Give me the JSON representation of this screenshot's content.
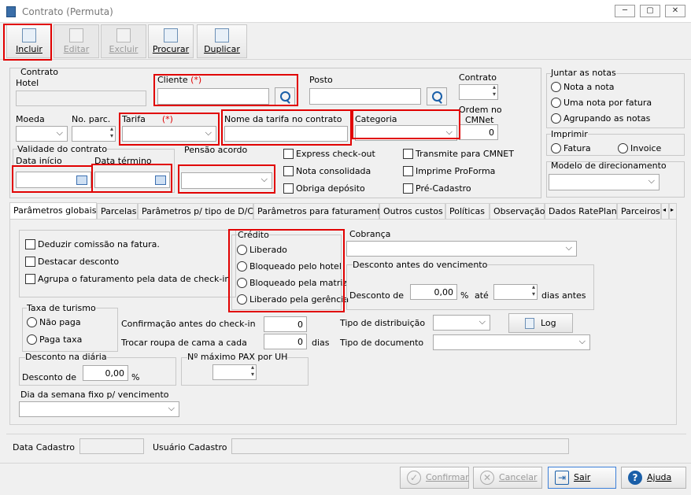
{
  "window": {
    "title": "Contrato (Permuta)",
    "min": "─",
    "max": "▢",
    "close": "✕"
  },
  "toolbar": {
    "incluir": "Incluir",
    "editar": "Editar",
    "excluir": "Excluir",
    "procurar": "Procurar",
    "duplicar": "Duplicar"
  },
  "contrato_group": {
    "label": "Contrato",
    "hotel": "Hotel"
  },
  "cliente": {
    "label": "Cliente",
    "req": "(*)",
    "value": ""
  },
  "posto": {
    "label": "Posto",
    "value": ""
  },
  "contrato_num": {
    "label": "Contrato",
    "value": ""
  },
  "ordem": {
    "label1": "Ordem no",
    "label2": "CMNet",
    "value": "0"
  },
  "moeda": {
    "label": "Moeda"
  },
  "noparc": {
    "label": "No. parc."
  },
  "tarifa": {
    "label": "Tarifa",
    "req": "(*)"
  },
  "nome_tarifa": {
    "label": "Nome da tarifa no contrato"
  },
  "categoria": {
    "label": "Categoria"
  },
  "validade": {
    "label": "Validade do contrato",
    "inicio": "Data início",
    "termino": "Data término"
  },
  "pensao": {
    "label": "Pensão acordo"
  },
  "checks": {
    "express": "Express check-out",
    "nota_consolidada": "Nota consolidada",
    "obriga": "Obriga depósito",
    "transmite": "Transmite para CMNET",
    "proforma": "Imprime ProForma",
    "precadastro": "Pré-Cadastro"
  },
  "juntar": {
    "label": "Juntar as notas",
    "opt1": "Nota a nota",
    "opt2": "Uma nota por fatura",
    "opt3": "Agrupando as notas"
  },
  "imprimir": {
    "label": "Imprimir",
    "opt1": "Fatura",
    "opt2": "Invoice"
  },
  "direcionamento": {
    "label": "Modelo de direcionamento"
  },
  "tabs": [
    "Parâmetros globais",
    "Parcelas",
    "Parâmetros p/ tipo de D/C",
    "Parâmetros para faturamento",
    "Outros custos",
    "Políticas",
    "Observação",
    "Dados RatePlan",
    "Parceiros"
  ],
  "panel": {
    "deduzir": "Deduzir comissão na fatura.",
    "destacar": "Destacar desconto",
    "agrupa": "Agrupa o faturamento pela data de check-in",
    "credito": {
      "label": "Crédito",
      "o1": "Liberado",
      "o2": "Bloqueado pelo hotel",
      "o3": "Bloqueado pela matriz",
      "o4": "Liberado pela gerência"
    },
    "cobranca": "Cobrança",
    "desc_venc": {
      "label": "Desconto antes do vencimento",
      "desconto_de": "Desconto de",
      "value": "0,00",
      "pct": "%",
      "ate": "até",
      "dias": "dias antes"
    },
    "turismo": {
      "label": "Taxa de turismo",
      "o1": "Não paga",
      "o2": "Paga taxa"
    },
    "confirmacao": {
      "label": "Confirmação antes do check-in",
      "value": "0"
    },
    "roupa": {
      "label": "Trocar roupa de cama a cada",
      "value": "0",
      "unit": "dias"
    },
    "distribuicao": "Tipo de distribuição",
    "log": "Log",
    "documento": "Tipo de documento",
    "diaria": {
      "label": "Desconto na diária",
      "desconto_de": "Desconto de",
      "value": "0,00",
      "pct": "%"
    },
    "pax": "Nº máximo PAX por UH",
    "dia_semana": "Dia da semana fixo p/ vencimento"
  },
  "footer": {
    "data_cadastro": "Data Cadastro",
    "usuario_cadastro": "Usuário Cadastro"
  },
  "buttons": {
    "confirmar": "Confirmar",
    "cancelar": "Cancelar",
    "sair": "Sair",
    "ajuda": "Ajuda"
  }
}
